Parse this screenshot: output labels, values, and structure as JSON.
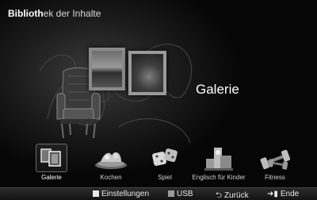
{
  "header": {
    "title_bold": "Biblioth",
    "title_rest": "ek der Inhalte"
  },
  "main": {
    "section_title": "Galerie"
  },
  "items": [
    {
      "label": "Galerie",
      "icon": "gallery-icon",
      "selected": true
    },
    {
      "label": "Kochen",
      "icon": "cooking-icon",
      "selected": false
    },
    {
      "label": "Spiel",
      "icon": "dice-icon",
      "selected": false
    },
    {
      "label": "Englisch für Kinder",
      "icon": "toys-icon",
      "selected": false
    },
    {
      "label": "Fitness",
      "icon": "dumbbell-icon",
      "selected": false
    }
  ],
  "bottom_bar": {
    "settings_label": "Einstellungen",
    "usb_label": "USB",
    "back_label": "Zurück",
    "exit_label": "Ende"
  },
  "colors": {
    "settings_square": "#e6e6e6",
    "usb_square": "#9a9a9a"
  }
}
